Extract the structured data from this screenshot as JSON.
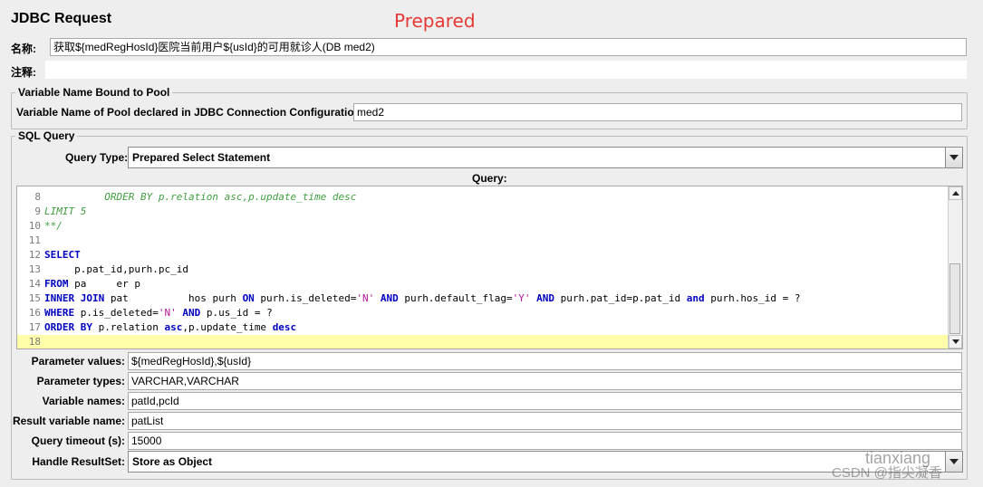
{
  "header": {
    "title": "JDBC Request",
    "annotation": "Prepared"
  },
  "name_row": {
    "label": "名称:",
    "value": "获取${medRegHosId}医院当前用户${usId}的可用就诊人(DB med2)"
  },
  "comment_row": {
    "label": "注释:",
    "value": ""
  },
  "pool_group": {
    "title": "Variable Name Bound to Pool",
    "label": "Variable Name of Pool declared in JDBC Connection Configuration:",
    "value": "med2"
  },
  "sql_group": {
    "title": "SQL Query",
    "query_type_label": "Query Type:",
    "query_type_value": "Prepared Select Statement",
    "query_label": "Query:"
  },
  "editor": {
    "lines": [
      {
        "num": "8",
        "html": "<span class=\"cm\">          ORDER BY p.relation asc,p.update_time desc</span>"
      },
      {
        "num": "9",
        "html": "<span class=\"cm\">LIMIT 5</span>"
      },
      {
        "num": "10",
        "html": "<span class=\"cm\">**/</span>"
      },
      {
        "num": "11",
        "html": ""
      },
      {
        "num": "12",
        "html": "<span class=\"kw\">SELECT</span>"
      },
      {
        "num": "13",
        "html": "     p.pat_id,purh.pc_id"
      },
      {
        "num": "14",
        "html": "<span class=\"kw\">FROM</span> pa     er p"
      },
      {
        "num": "15",
        "html": "<span class=\"kw\">INNER JOIN</span> pat          hos purh <span class=\"kw\">ON</span> purh.is_deleted=<span class=\"st\">'N'</span> <span class=\"kw\">AND</span> purh.default_flag=<span class=\"st\">'Y'</span> <span class=\"kw\">AND</span> purh.pat_id=p.pat_id <span class=\"kw\">and</span> purh.hos_id = ?"
      },
      {
        "num": "16",
        "html": "<span class=\"kw\">WHERE</span> p.is_deleted=<span class=\"st\">'N'</span> <span class=\"kw\">AND</span> p.us_id = ?"
      },
      {
        "num": "17",
        "html": "<span class=\"kw\">ORDER BY</span> p.relation <span class=\"kw\">asc</span>,p.update_time <span class=\"kw\">desc</span>"
      },
      {
        "num": "18",
        "html": ""
      }
    ]
  },
  "params": {
    "parameter_values_label": "Parameter values:",
    "parameter_values": "${medRegHosId},${usId}",
    "parameter_types_label": "Parameter types:",
    "parameter_types": "VARCHAR,VARCHAR",
    "variable_names_label": "Variable names:",
    "variable_names": "patId,pcId",
    "result_variable_label": "Result variable name:",
    "result_variable": "patList",
    "query_timeout_label": "Query timeout (s):",
    "query_timeout": "15000",
    "handle_resultset_label": "Handle ResultSet:",
    "handle_resultset": "Store as Object"
  },
  "watermark": {
    "text1": "tianxiang",
    "text2": "CSDN @指尖凝香"
  },
  "colors": {
    "annotation": "#e53935",
    "keyword": "#0000c0",
    "comment": "#3f9f3f",
    "string": "#b5179e",
    "highlight_line": "#ffffaa"
  }
}
